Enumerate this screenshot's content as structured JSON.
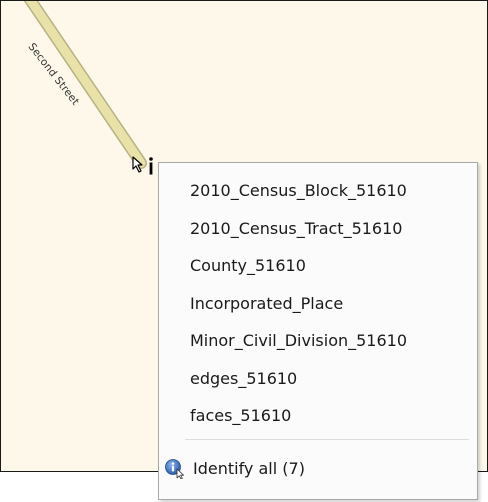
{
  "map": {
    "street_label": "Second Street",
    "background_color": "#fdf8ea",
    "road_color": "#e8e2a8"
  },
  "context_menu": {
    "layers": [
      {
        "label": "2010_Census_Block_51610"
      },
      {
        "label": "2010_Census_Tract_51610"
      },
      {
        "label": "County_51610"
      },
      {
        "label": "Incorporated_Place"
      },
      {
        "label": "Minor_Civil_Division_51610"
      },
      {
        "label": "edges_51610"
      },
      {
        "label": "faces_51610"
      }
    ],
    "identify_all": {
      "label": "Identify all (7)",
      "icon": "identify-info-icon"
    }
  },
  "cursor": {
    "icon": "identify-cursor-icon"
  }
}
